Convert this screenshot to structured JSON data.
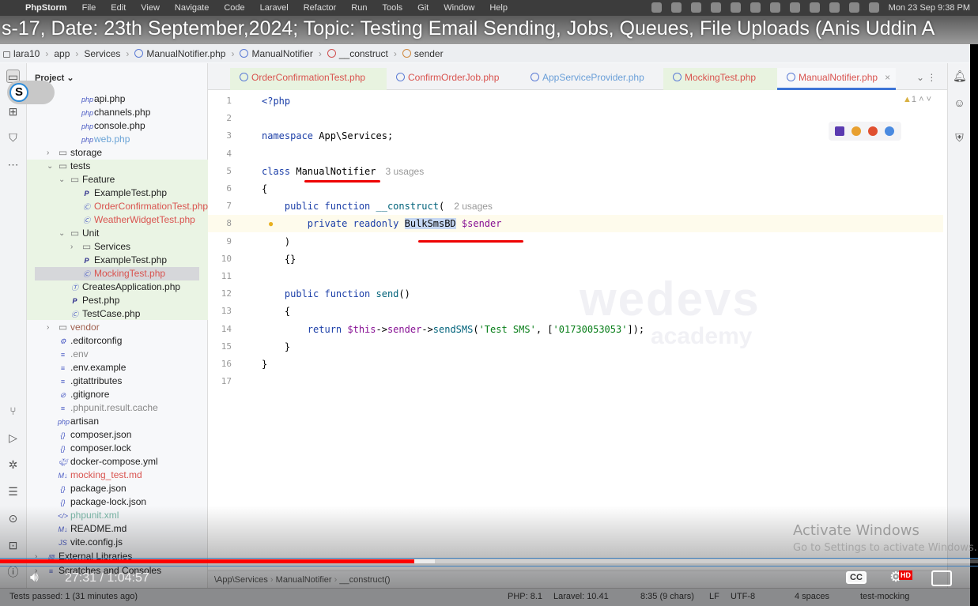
{
  "menubar": {
    "app": "PhpStorm",
    "items": [
      "File",
      "Edit",
      "View",
      "Navigate",
      "Code",
      "Laravel",
      "Refactor",
      "Run",
      "Tools",
      "Git",
      "Window",
      "Help"
    ],
    "clock": "Mon 23 Sep  9:38 PM"
  },
  "video": {
    "title": "s-17, Date: 23th September,2024; Topic: Testing Email Sending, Jobs, Queues, File Uploads (Anis Uddin A",
    "current_time": "27:31",
    "duration": "1:04:57",
    "separator": "/",
    "progress_fraction": 0.424,
    "buffered_fraction": 0.445,
    "hd_badge": "HD"
  },
  "breadcrumb": [
    {
      "label": "lara10",
      "icon": "folder"
    },
    {
      "label": "app"
    },
    {
      "label": "Services"
    },
    {
      "label": "ManualNotifier.php",
      "icon": "class"
    },
    {
      "label": "ManualNotifier",
      "icon": "class"
    },
    {
      "label": "__construct",
      "icon": "method"
    },
    {
      "label": "sender",
      "icon": "property"
    }
  ],
  "project": {
    "header": "Project",
    "badge": "S",
    "items": [
      {
        "label": "api.php",
        "depth": 3,
        "icon": "php"
      },
      {
        "label": "channels.php",
        "depth": 3,
        "icon": "php"
      },
      {
        "label": "console.php",
        "depth": 3,
        "icon": "php"
      },
      {
        "label": "web.php",
        "depth": 3,
        "icon": "php",
        "color": "blue"
      },
      {
        "label": "storage",
        "depth": 1,
        "icon": "folder",
        "arrow": "›"
      },
      {
        "label": "tests",
        "depth": 1,
        "icon": "folder",
        "arrow": "⌄"
      },
      {
        "label": "Feature",
        "depth": 2,
        "icon": "folder",
        "arrow": "⌄"
      },
      {
        "label": "ExampleTest.php",
        "depth": 3,
        "icon": "pest"
      },
      {
        "label": "OrderConfirmationTest.php",
        "depth": 3,
        "icon": "test",
        "color": "red"
      },
      {
        "label": "WeatherWidgetTest.php",
        "depth": 3,
        "icon": "test",
        "color": "red"
      },
      {
        "label": "Unit",
        "depth": 2,
        "icon": "folder",
        "arrow": "⌄"
      },
      {
        "label": "Services",
        "depth": 3,
        "icon": "folder",
        "arrow": "›"
      },
      {
        "label": "ExampleTest.php",
        "depth": 3,
        "icon": "pest"
      },
      {
        "label": "MockingTest.php",
        "depth": 3,
        "icon": "test",
        "color": "red",
        "selected": true
      },
      {
        "label": "CreatesApplication.php",
        "depth": 2,
        "icon": "trait"
      },
      {
        "label": "Pest.php",
        "depth": 2,
        "icon": "pest"
      },
      {
        "label": "TestCase.php",
        "depth": 2,
        "icon": "test"
      },
      {
        "label": "vendor",
        "depth": 1,
        "icon": "folder",
        "arrow": "›",
        "color": "brown"
      },
      {
        "label": ".editorconfig",
        "depth": 1,
        "icon": "gear"
      },
      {
        "label": ".env",
        "depth": 1,
        "icon": "text",
        "color": "gray"
      },
      {
        "label": ".env.example",
        "depth": 1,
        "icon": "text"
      },
      {
        "label": ".gitattributes",
        "depth": 1,
        "icon": "text"
      },
      {
        "label": ".gitignore",
        "depth": 1,
        "icon": "ignore"
      },
      {
        "label": ".phpunit.result.cache",
        "depth": 1,
        "icon": "text",
        "color": "gray"
      },
      {
        "label": "artisan",
        "depth": 1,
        "icon": "php"
      },
      {
        "label": "composer.json",
        "depth": 1,
        "icon": "json"
      },
      {
        "label": "composer.lock",
        "depth": 1,
        "icon": "json"
      },
      {
        "label": "docker-compose.yml",
        "depth": 1,
        "icon": "docker"
      },
      {
        "label": "mocking_test.md",
        "depth": 1,
        "icon": "md",
        "color": "red"
      },
      {
        "label": "package.json",
        "depth": 1,
        "icon": "json"
      },
      {
        "label": "package-lock.json",
        "depth": 1,
        "icon": "json"
      },
      {
        "label": "phpunit.xml",
        "depth": 1,
        "icon": "xml",
        "color": "teal"
      },
      {
        "label": "README.md",
        "depth": 1,
        "icon": "md"
      },
      {
        "label": "vite.config.js",
        "depth": 1,
        "icon": "js"
      },
      {
        "label": "External Libraries",
        "depth": 0,
        "icon": "library",
        "arrow": "›"
      },
      {
        "label": "Scratches and Consoles",
        "depth": 0,
        "icon": "scratch",
        "arrow": "›"
      }
    ]
  },
  "tabs": [
    {
      "label": "OrderConfirmationTest.php",
      "style": "test"
    },
    {
      "label": "ConfirmOrderJob.php",
      "style": "class"
    },
    {
      "label": "AppServiceProvider.php",
      "style": "class-blue"
    },
    {
      "label": "MockingTest.php",
      "style": "test"
    },
    {
      "label": "ManualNotifier.php",
      "style": "active"
    }
  ],
  "editor": {
    "warnings": "1",
    "lines": [
      [
        [
          "kw",
          "<?php"
        ]
      ],
      [],
      [
        [
          "kw",
          "namespace "
        ],
        [
          "cls",
          "App\\Services;"
        ]
      ],
      [],
      [
        [
          "kw",
          "class "
        ],
        [
          "cls",
          "ManualNotifier"
        ],
        [
          "hint",
          "3 usages"
        ]
      ],
      [
        [
          "cls",
          "{"
        ]
      ],
      [
        [
          "cls",
          "    "
        ],
        [
          "kw",
          "public function "
        ],
        [
          "fn",
          "__construct"
        ],
        [
          "cls",
          "("
        ],
        [
          "hint",
          "2 usages"
        ]
      ],
      [
        [
          "cls",
          "        "
        ],
        [
          "kw",
          "private readonly "
        ],
        [
          "hl",
          "BulkSmsBD"
        ],
        [
          "cls",
          " "
        ],
        [
          "var",
          "$sender"
        ]
      ],
      [
        [
          "cls",
          "    )"
        ]
      ],
      [
        [
          "cls",
          "    {}"
        ]
      ],
      [],
      [
        [
          "cls",
          "    "
        ],
        [
          "kw",
          "public function "
        ],
        [
          "fn",
          "send"
        ],
        [
          "cls",
          "()"
        ]
      ],
      [
        [
          "cls",
          "    {"
        ]
      ],
      [
        [
          "cls",
          "        "
        ],
        [
          "kw",
          "return "
        ],
        [
          "var",
          "$this"
        ],
        [
          "cls",
          "->"
        ],
        [
          "var",
          "sender"
        ],
        [
          "cls",
          "->"
        ],
        [
          "fn",
          "sendSMS"
        ],
        [
          "cls",
          "("
        ],
        [
          "str",
          "'Test SMS'"
        ],
        [
          "cls",
          ", ["
        ],
        [
          "str",
          "'01730053053'"
        ],
        [
          "cls",
          "]);"
        ]
      ],
      [
        [
          "cls",
          "    }"
        ]
      ],
      [
        [
          "cls",
          "}"
        ]
      ],
      []
    ]
  },
  "watermark": {
    "brand": "wedevs",
    "sub": "academy"
  },
  "editor_breadcrumb": [
    "\\App\\Services",
    "ManualNotifier",
    "__construct()"
  ],
  "status": {
    "tests": "Tests passed: 1 (31 minutes ago)",
    "php": "PHP: 8.1",
    "laravel": "Laravel: 10.41",
    "position": "8:35 (9 chars)",
    "line_ending": "LF",
    "encoding": "UTF-8",
    "indent": "4 spaces",
    "branch": "test-mocking"
  },
  "activation": {
    "title": "Activate Windows",
    "subtitle": "Go to Settings to activate Windows."
  }
}
